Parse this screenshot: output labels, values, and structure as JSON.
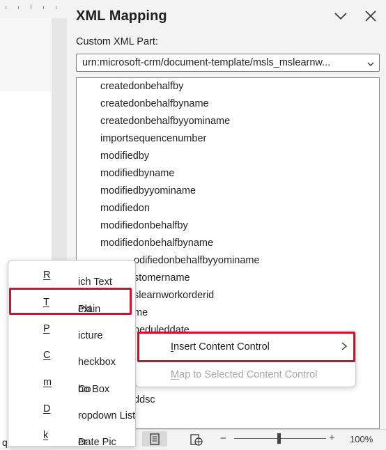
{
  "pane": {
    "title": "XML Mapping",
    "custom_part_label": "Custom XML Part:",
    "custom_part_value": "urn:microsoft-crm/document-template/msls_mslearnw...",
    "chevron_icon": "chevron-down-icon",
    "close_icon": "close-icon"
  },
  "tree": {
    "items": [
      "createdonbehalfby",
      "createdonbehalfbyname",
      "createdonbehalfbyyominame",
      "importsequencenumber",
      "modifiedby",
      "modifiedbyname",
      "modifiedbyyominame",
      "modifiedon",
      "modifiedonbehalfby",
      "modifiedonbehalfbyname",
      "odifiedonbehalfbyyominame",
      "stomername",
      "slearnworkorderid",
      "me",
      "heduleddate",
      "",
      "ddsc"
    ]
  },
  "content_control_menu": {
    "items": [
      {
        "pre": "",
        "u": "R",
        "post": "ich Text"
      },
      {
        "pre": "Plain ",
        "u": "T",
        "post": "ext"
      },
      {
        "pre": "",
        "u": "P",
        "post": "icture"
      },
      {
        "pre": "",
        "u": "C",
        "post": "heckbox"
      },
      {
        "pre": "Co",
        "u": "m",
        "post": "bo Box"
      },
      {
        "pre": "",
        "u": "D",
        "post": "ropdown List"
      },
      {
        "pre": "Date Pic",
        "u": "k",
        "post": "er"
      }
    ],
    "highlighted": "Plain Text"
  },
  "context_menu": {
    "items": [
      {
        "pre": "",
        "u": "I",
        "post": "nsert Content Control",
        "enabled": true
      },
      {
        "pre": "",
        "u": "M",
        "post": "ap to Selected Content Control",
        "enabled": false
      }
    ],
    "arrow_icon": "chevron-right-icon"
  },
  "doc": {
    "stray_letter": "q"
  },
  "statusbar": {
    "print_layout_icon": "print-layout-icon",
    "web_layout_icon": "web-layout-icon",
    "zoom_minus": "−",
    "zoom_plus": "+",
    "zoom_level": "100%",
    "zoom_fraction": 0.48
  },
  "colors": {
    "highlight_border": "#d0112b",
    "disabled_text": "#a6a6a6"
  }
}
